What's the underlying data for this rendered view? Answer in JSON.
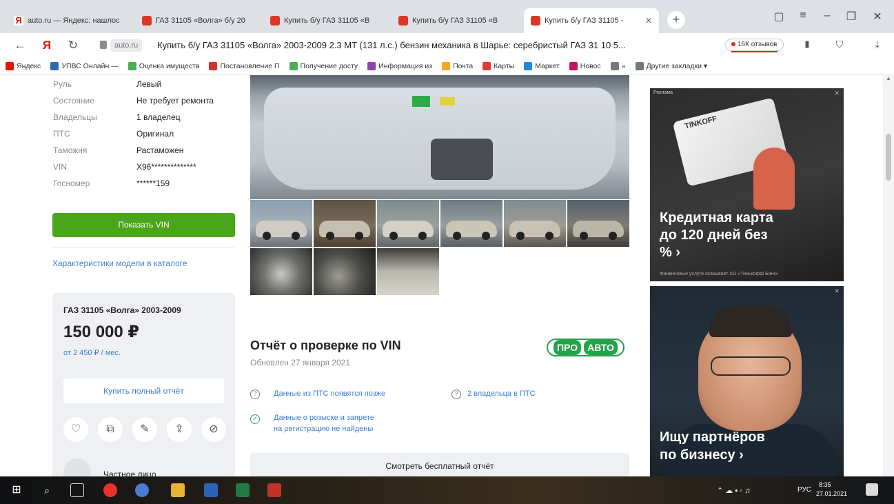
{
  "browser": {
    "tabs": [
      {
        "label": "auto.ru — Яндекс: нашлос",
        "favicon": "yandex-icon",
        "active": false
      },
      {
        "label": "ГАЗ 31105 «Волга» б/у 20",
        "favicon": "autoru-icon",
        "active": false
      },
      {
        "label": "Купить б/у ГАЗ 31105 «В",
        "favicon": "autoru-icon",
        "active": false
      },
      {
        "label": "Купить б/у ГАЗ 31105 «В",
        "favicon": "autoru-icon",
        "active": false
      },
      {
        "label": "Купить б/у ГАЗ 31105 -",
        "favicon": "autoru-icon",
        "active": true
      }
    ],
    "new_tab_glyph": "+",
    "domain": "auto.ru",
    "page_title": "Купить б/у ГАЗ 31105 «Волга» 2003-2009 2.3 MT (131 л.с.) бензин механика в Шарье: серебристый ГАЗ 31 10 5...",
    "reviews_badge": "16К отзывов",
    "bookmarks": [
      {
        "label": "Яндекс",
        "icon": "yandex-icon",
        "color": "#e61400"
      },
      {
        "label": "УПВС Онлайн — ",
        "icon": "upvs-icon",
        "color": "#2b6cb0"
      },
      {
        "label": "Оценка имуществ",
        "icon": "gosuslugi-icon",
        "color": "#4caf50"
      },
      {
        "label": "Постановление П",
        "icon": "doc-icon",
        "color": "#d32f2f"
      },
      {
        "label": "Получение досту",
        "icon": "gosuslugi-icon",
        "color": "#4caf50"
      },
      {
        "label": "Информация из",
        "icon": "info-icon",
        "color": "#8e44ad"
      },
      {
        "label": "Почта",
        "icon": "mail-icon",
        "color": "#f5a623"
      },
      {
        "label": "Карты",
        "icon": "maps-icon",
        "color": "#e53935"
      },
      {
        "label": "Маркет",
        "icon": "market-icon",
        "color": "#1e88e5"
      },
      {
        "label": "Новос",
        "icon": "news-icon",
        "color": "#c2185b"
      },
      {
        "label": "»",
        "icon": "more-icon",
        "color": "#777777"
      },
      {
        "label": "Другие закладки ▾",
        "icon": "folder-icon",
        "color": "#777777"
      }
    ]
  },
  "specs": [
    {
      "label": "Руль",
      "value": "Левый"
    },
    {
      "label": "Состояние",
      "value": "Не требует ремонта"
    },
    {
      "label": "Владельцы",
      "value": "1 владелец"
    },
    {
      "label": "ПТС",
      "value": "Оригинал"
    },
    {
      "label": "Таможня",
      "value": "Растаможен"
    },
    {
      "label": "VIN",
      "value": "X96**************"
    },
    {
      "label": "Госномер",
      "value": "******159"
    }
  ],
  "show_vin_button": "Показать VIN",
  "catalog_link": "Характеристики модели в каталоге",
  "price_card": {
    "title": "ГАЗ 31105 «Волга» 2003-2009",
    "price": "150 000 ₽",
    "credit": "от 2 450 ₽ / мес.",
    "full_report_button": "Купить полный отчёт",
    "actions": [
      "heart-icon",
      "compare-icon",
      "note-icon",
      "share-icon",
      "block-icon"
    ],
    "seller": "Частное лицо"
  },
  "report": {
    "title": "Отчёт о проверке по VIN",
    "updated": "Обновлен 27 января 2021",
    "badge_pro": "ПРО",
    "badge_avto": "АВТО",
    "items": [
      {
        "text": "Данные из ПТС появятся позже",
        "icon": "question-icon"
      },
      {
        "text": "2 владельца в ПТС",
        "icon": "question-icon"
      },
      {
        "text_line1": "Данные о розыске и запрете",
        "text_line2": "на регистрацию не найдены",
        "icon": "check-icon"
      }
    ],
    "free_report_button": "Смотреть бесплатный отчёт"
  },
  "ads": {
    "label": "Реклама",
    "card_brand": "TINKOFF",
    "ad1_line1": "Кредитная карта",
    "ad1_line2": "до 120 дней без",
    "ad1_line3": "% ›",
    "ad1_small": "Финансовые услуги оказывает АО «Тинькофф Банк»",
    "ad2_line1": "Ищу партнёров",
    "ad2_line2": "по бизнесу ›"
  },
  "taskbar": {
    "lang": "РУС",
    "time": "8:35",
    "date": "27.01.2021"
  },
  "colors": {
    "accent_green": "#49a519",
    "link_blue": "#3d7fd0",
    "proauto_green": "#24a34a"
  }
}
